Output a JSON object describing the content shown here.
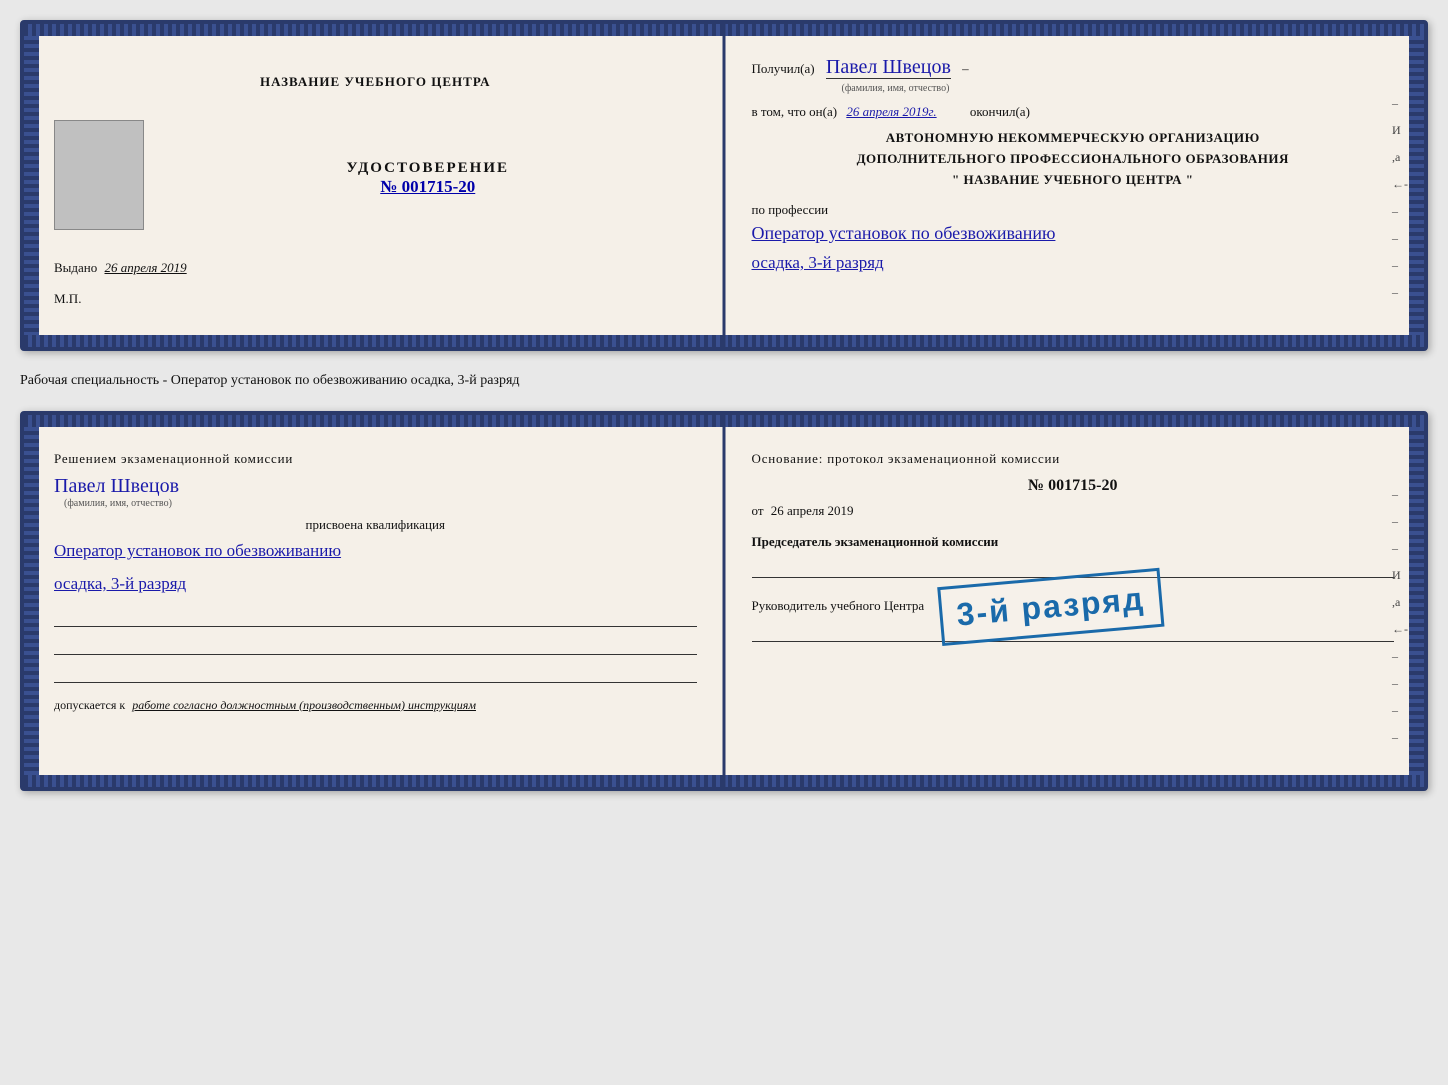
{
  "doc1": {
    "left": {
      "center_title": "НАЗВАНИЕ УЧЕБНОГО ЦЕНТРА",
      "cert_label": "УДОСТОВЕРЕНИЕ",
      "cert_number": "№ 001715-20",
      "issued_prefix": "Выдано",
      "issued_date": "26 апреля 2019",
      "mp_label": "М.П."
    },
    "right": {
      "received_prefix": "Получил(а)",
      "recipient_name": "Павел Швецов",
      "recipient_label": "(фамилия, имя, отчество)",
      "fact_prefix": "в том, что он(а)",
      "fact_date": "26 апреля 2019г.",
      "fact_suffix": "окончил(а)",
      "org_line1": "АВТОНОМНУЮ НЕКОММЕРЧЕСКУЮ ОРГАНИЗАЦИЮ",
      "org_line2": "ДОПОЛНИТЕЛЬНОГО ПРОФЕССИОНАЛЬНОГО ОБРАЗОВАНИЯ",
      "org_line3": "\" НАЗВАНИЕ УЧЕБНОГО ЦЕНТРА \"",
      "profession_prefix": "по профессии",
      "profession_value": "Оператор установок по обезвоживанию",
      "profession_rank": "осадка, 3-й разряд"
    }
  },
  "between_label": "Рабочая специальность - Оператор установок по обезвоживанию осадка, 3-й разряд",
  "doc2": {
    "left": {
      "decision_text": "Решением экзаменационной комиссии",
      "name_value": "Павел Швецов",
      "name_label": "(фамилия, имя, отчество)",
      "qualification_label": "присвоена квалификация",
      "qualification_line1": "Оператор установок по обезвоживанию",
      "qualification_line2": "осадка, 3-й разряд",
      "allowed_prefix": "допускается к",
      "allowed_value": "работе согласно должностным (производственным) инструкциям"
    },
    "right": {
      "basis_text": "Основание: протокол экзаменационной комиссии",
      "protocol_number": "№ 001715-20",
      "from_prefix": "от",
      "from_date": "26 апреля 2019",
      "chairman_label": "Председатель экзаменационной комиссии",
      "head_label": "Руководитель учебного Центра"
    },
    "stamp": "3-й разряд"
  }
}
